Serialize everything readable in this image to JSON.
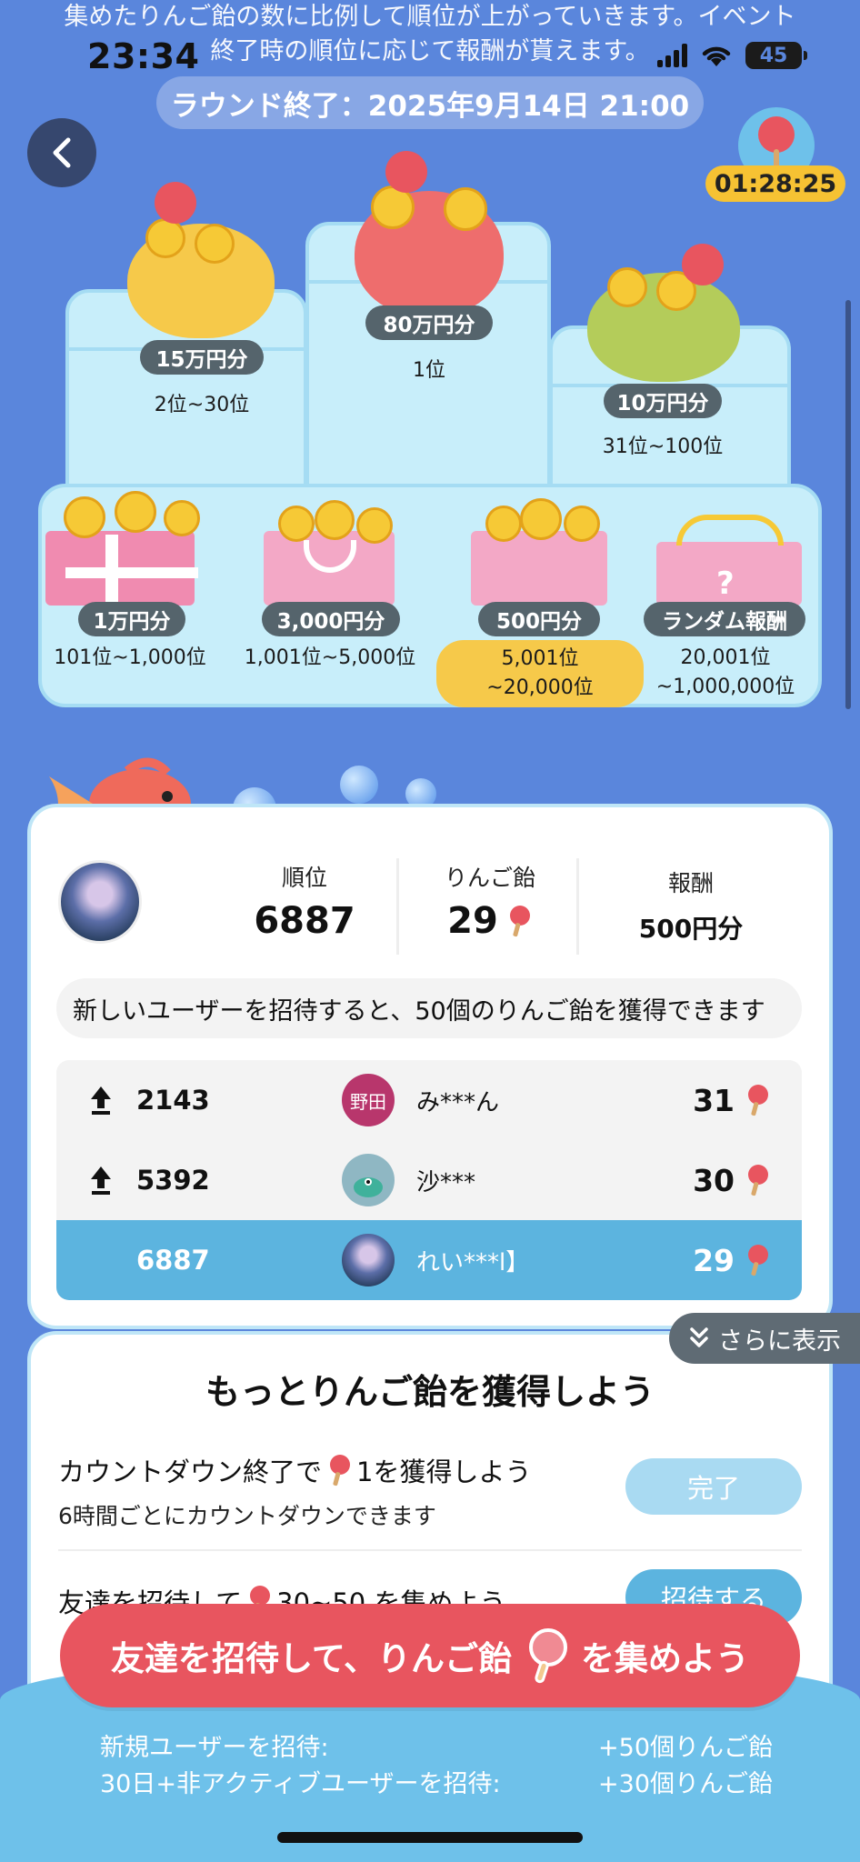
{
  "header": {
    "description": "集めたりんご飴の数に比例して順位が上がっていきます。イベント終了時の順位に応じて報酬が貰えます。",
    "status_time": "23:34",
    "battery": "45",
    "round_end": "ラウンド終了：2025年9月14日 21:00",
    "countdown": "01:28:25"
  },
  "podium": {
    "first": {
      "prize": "80万円分",
      "rank": "1位"
    },
    "second": {
      "prize": "15万円分",
      "rank": "2位~30位"
    },
    "third": {
      "prize": "10万円分",
      "rank": "31位~100位"
    },
    "tiers": [
      {
        "prize": "1万円分",
        "rank": "101位~1,000位"
      },
      {
        "prize": "3,000円分",
        "rank": "1,001位~5,000位"
      },
      {
        "prize": "500円分",
        "rank_line1": "5,001位",
        "rank_line2": "~20,000位"
      },
      {
        "prize": "ランダム報酬",
        "rank_line1": "20,001位",
        "rank_line2": "~1,000,000位"
      }
    ]
  },
  "my_stats": {
    "rank_label": "順位",
    "rank_value": "6887",
    "candy_label": "りんご飴",
    "candy_value": "29",
    "reward_label": "報酬",
    "reward_value": "500円分"
  },
  "invite_note": "新しいユーザーを招待すると、50個のりんご飴を獲得できます",
  "leaderboard": [
    {
      "rank": "2143",
      "avatar_text": "野田",
      "name": "み***ん",
      "count": "31",
      "trend": "up"
    },
    {
      "rank": "5392",
      "avatar_text": "",
      "name": "沙***",
      "count": "30",
      "trend": "up"
    },
    {
      "rank": "6887",
      "avatar_text": "",
      "name": "れい***l】",
      "count": "29",
      "trend": ""
    }
  ],
  "show_more": "さらに表示",
  "earn": {
    "title": "もっとりんご飴を獲得しよう",
    "task1_prefix": "カウントダウン終了で",
    "task1_suffix": "1を獲得しよう",
    "task1_sub": "6時間ごとにカウントダウンできます",
    "task1_button": "完了",
    "task2_prefix": "友達を招待して",
    "task2_suffix": "30~50 を集めよう",
    "task2_button": "招待する"
  },
  "cta": {
    "prefix": "友達を招待して、りんご飴",
    "suffix": "を集めよう"
  },
  "bonus": {
    "new_user_label": "新規ユーザーを招待:",
    "new_user_value": "+50個りんご飴",
    "inactive_label": "30日+非アクティブユーザーを招待:",
    "inactive_value": "+30個りんご飴"
  },
  "colors": {
    "background": "#5a86dc",
    "accent_red": "#e8555f",
    "highlight_blue": "#5cb4df",
    "gold": "#f6c233"
  }
}
